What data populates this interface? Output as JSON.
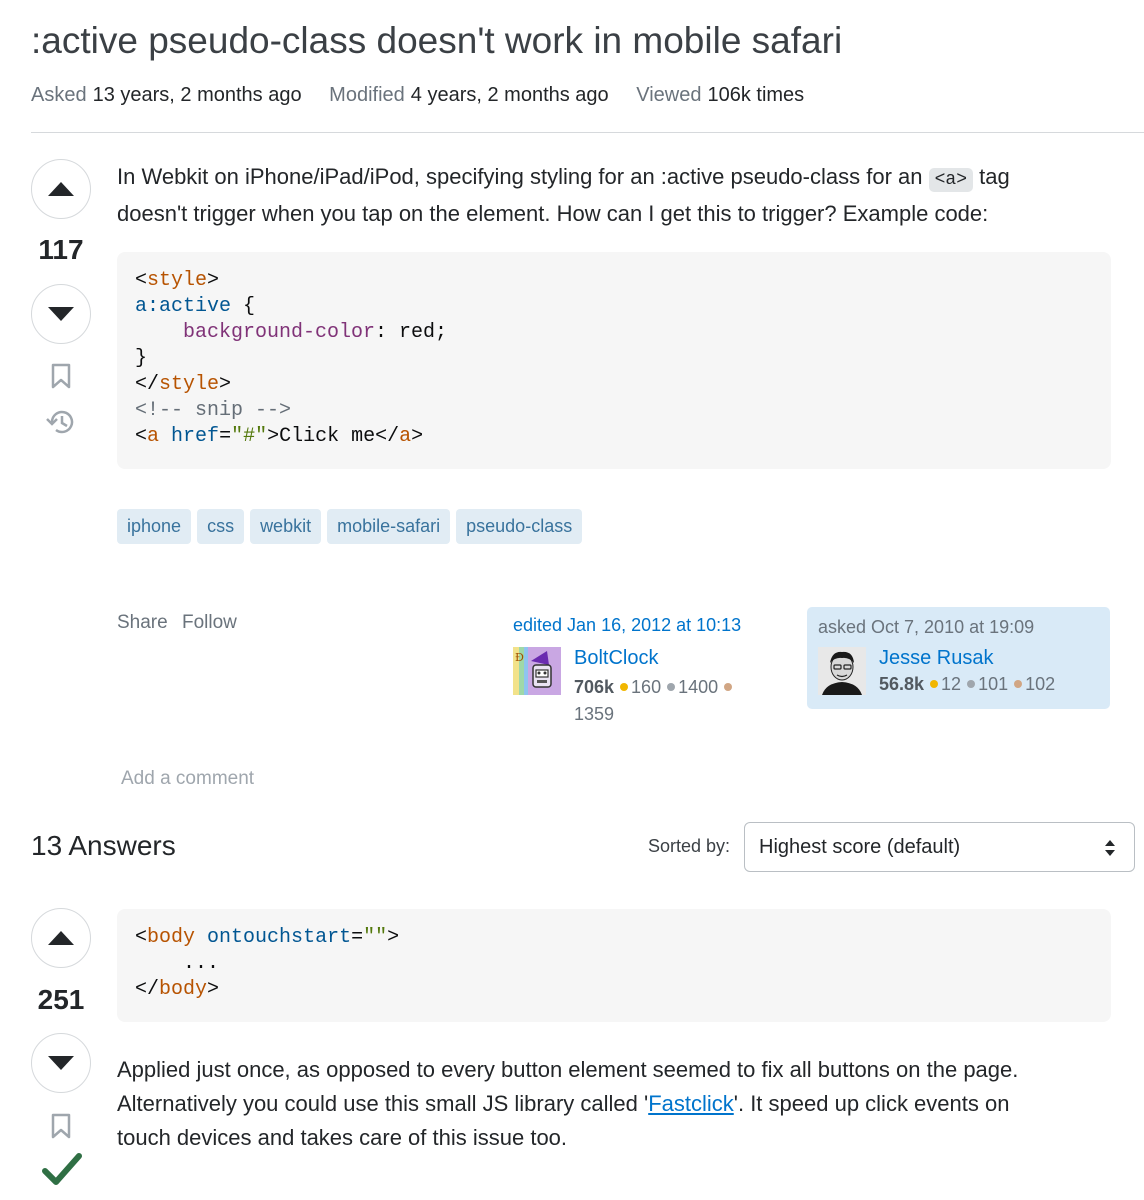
{
  "question": {
    "title": ":active pseudo-class doesn't work in mobile safari",
    "meta": {
      "asked_label": "Asked",
      "asked_value": "13 years, 2 months ago",
      "modified_label": "Modified",
      "modified_value": "4 years, 2 months ago",
      "viewed_label": "Viewed",
      "viewed_value": "106k times"
    },
    "score": "117",
    "body_part1": "In Webkit on iPhone/iPad/iPod, specifying styling for an :active pseudo-class for an",
    "body_code": "<a>",
    "body_part2": "tag",
    "body_line2": "doesn't trigger when you tap on the element. How can I get this to trigger? Example code:",
    "code": {
      "l1_open": "<",
      "l1_tag": "style",
      "l1_close": ">",
      "l2_sel": "a:active",
      "l2_rest": " {",
      "l3_indent": "    ",
      "l3_prop": "background-color",
      "l3_rest": ": red;",
      "l4": "}",
      "l5_open": "</",
      "l5_tag": "style",
      "l5_close": ">",
      "l6_comment": "<!-- snip -->",
      "l7_open": "<",
      "l7_tag": "a",
      "l7_sp": " ",
      "l7_attr": "href",
      "l7_eq": "=",
      "l7_str": "\"#\"",
      "l7_mid": ">Click me</",
      "l7_tag2": "a",
      "l7_close": ">"
    },
    "tags": [
      "iphone",
      "css",
      "webkit",
      "mobile-safari",
      "pseudo-class"
    ],
    "actions": {
      "share": "Share",
      "follow": "Follow"
    },
    "editor": {
      "action": "edited Jan 16, 2012 at 10:13",
      "name": "BoltClock",
      "rep": "706k",
      "gold": "160",
      "silver": "1400",
      "bronze": "1359"
    },
    "asker": {
      "action": "asked Oct 7, 2010 at 19:09",
      "name": "Jesse Rusak",
      "rep": "56.8k",
      "gold": "12",
      "silver": "101",
      "bronze": "102"
    },
    "add_comment": "Add a comment"
  },
  "answers_header": {
    "count_label": "13 Answers",
    "sorted_label": "Sorted by:",
    "sort_value": "Highest score (default)"
  },
  "answer": {
    "score": "251",
    "code": {
      "l1_open": "<",
      "l1_tag": "body",
      "l1_sp": " ",
      "l1_attr": "ontouchstart",
      "l1_eq": "=",
      "l1_str": "\"\"",
      "l1_close": ">",
      "l2": "    ...",
      "l3_open": "</",
      "l3_tag": "body",
      "l3_close": ">"
    },
    "text_line1": "Applied just once, as opposed to every button element seemed to fix all buttons on the page.",
    "text_line2_a": "Alternatively you could use this small JS library called '",
    "text_link": "Fastclick",
    "text_line2_b": "'. It speed up click events on",
    "text_line3": "touch devices and takes care of this issue too."
  },
  "colors": {
    "link": "#0074cc",
    "tag_bg": "#e1ecf4",
    "tag_text": "#39739d",
    "accepted": "#2f6f44",
    "gold": "#f1b600",
    "silver": "#9fa6ad",
    "bronze": "#d1a684"
  }
}
